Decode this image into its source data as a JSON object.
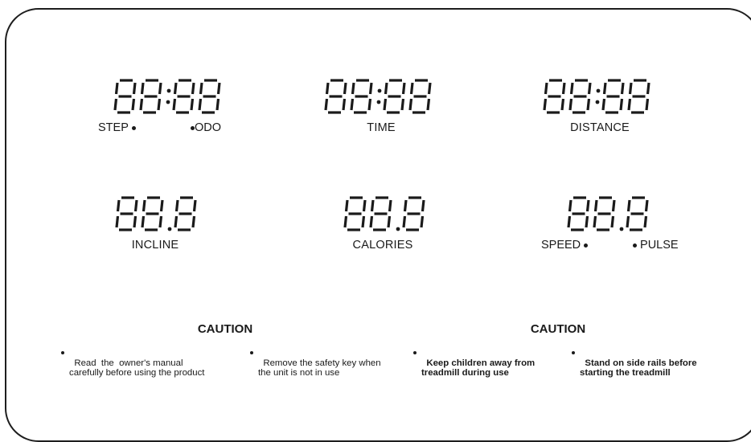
{
  "displays": {
    "step_odo": {
      "digits": "88:88",
      "label_left": "STEP",
      "label_right": "ODO"
    },
    "time": {
      "digits": "88:88",
      "label": "TIME"
    },
    "distance": {
      "digits": "88:88",
      "label": "DISTANCE"
    },
    "incline": {
      "digits": "88.8",
      "label": "INCLINE"
    },
    "calories": {
      "digits": "88.8",
      "label": "CALORIES"
    },
    "speed_pulse": {
      "digits": "88.8",
      "label_left": "SPEED",
      "label_right": "PULSE"
    }
  },
  "caution": {
    "left_heading": "CAUTION",
    "right_heading": "CAUTION",
    "items": [
      "Read  the  owner's manual\ncarefully before using the product",
      "Remove the safety key when\nthe unit is not in use",
      "Keep children away from\ntreadmill during use",
      "Stand on side rails before\nstarting the treadmill"
    ]
  }
}
